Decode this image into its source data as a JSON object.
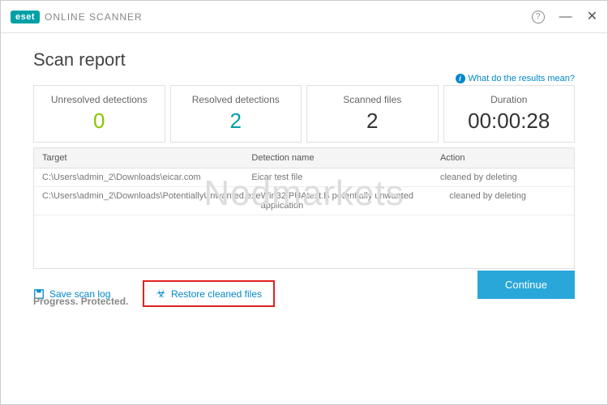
{
  "brand": {
    "logo": "eset",
    "product": "ONLINE SCANNER"
  },
  "window_controls": {
    "help": "?",
    "minimize": "—",
    "close": "✕"
  },
  "heading": "Scan report",
  "results_link": "What do the results mean?",
  "stats": {
    "unresolved": {
      "label": "Unresolved detections",
      "value": "0"
    },
    "resolved": {
      "label": "Resolved detections",
      "value": "2"
    },
    "scanned": {
      "label": "Scanned files",
      "value": "2"
    },
    "duration": {
      "label": "Duration",
      "value": "00:00:28"
    }
  },
  "table": {
    "headers": {
      "target": "Target",
      "detection": "Detection name",
      "action": "Action"
    },
    "rows": [
      {
        "target": "C:\\Users\\admin_2\\Downloads\\eicar.com",
        "detection": "Eicar test file",
        "action": "cleaned by deleting"
      },
      {
        "target": "C:\\Users\\admin_2\\Downloads\\PotentiallyUnwanted.exe",
        "detection": "Win32/PUAtest.B potentially unwanted application",
        "action": "cleaned by deleting"
      }
    ]
  },
  "watermark": "Nodmarkets",
  "actions": {
    "save_log": "Save scan log",
    "restore": "Restore cleaned files"
  },
  "continue_label": "Continue",
  "footer": "Progress. Protected."
}
